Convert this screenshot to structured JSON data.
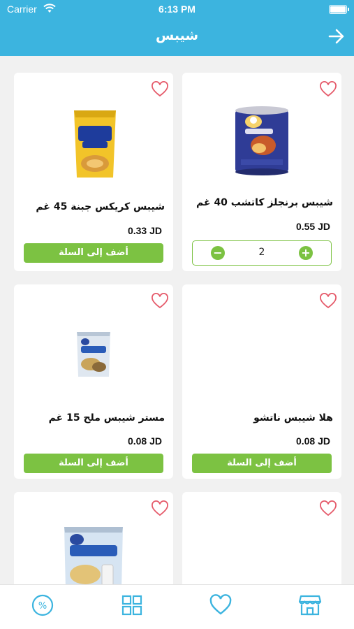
{
  "status_bar": {
    "carrier": "Carrier",
    "time": "6:13 PM"
  },
  "header": {
    "title": "شيبس"
  },
  "colors": {
    "primary": "#3cb4df",
    "accent_green": "#7cc242",
    "heart": "#e55a6a"
  },
  "products": [
    {
      "name": "شيبس برنجلز كاتشب 40 غم",
      "price": "0.55 JD",
      "quantity": "2",
      "image": "pringles-can"
    },
    {
      "name": "شيبس كريكس جبنة 45 غم",
      "price": "0.33 JD",
      "add_label": "أضف إلى السلة",
      "image": "crix-bag"
    },
    {
      "name": "هلا شيبس ناتشو",
      "price": "0.08 JD",
      "add_label": "أضف إلى السلة",
      "image": ""
    },
    {
      "name": "مستر شيبس ملح 15 غم",
      "price": "0.08 JD",
      "add_label": "أضف إلى السلة",
      "image": "mrchips-small-bag"
    },
    {
      "name": "",
      "price": "",
      "image": ""
    },
    {
      "name": "",
      "price": "",
      "image": "mrchips-large-bag"
    }
  ],
  "tabbar": {
    "items": [
      {
        "icon": "store-icon"
      },
      {
        "icon": "heart-icon"
      },
      {
        "icon": "grid-icon"
      },
      {
        "icon": "discount-icon"
      }
    ]
  }
}
